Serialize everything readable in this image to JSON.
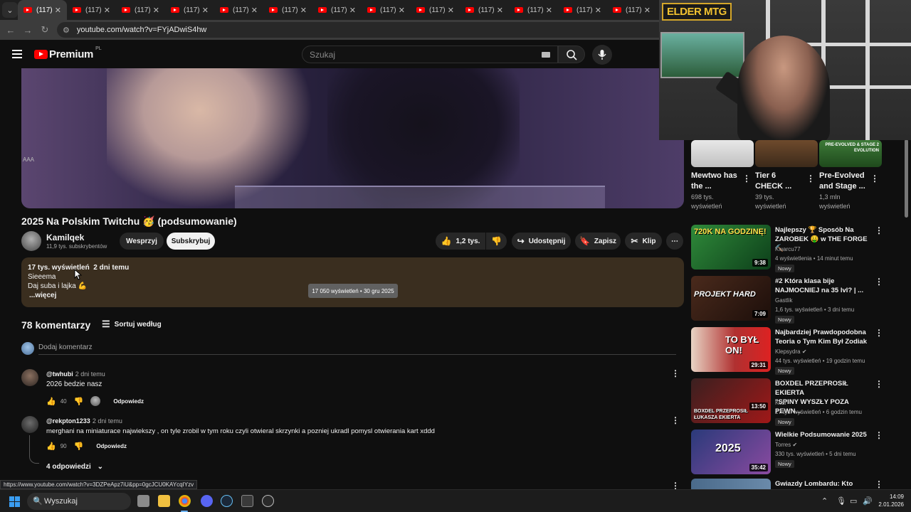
{
  "browser": {
    "tab_label": "(117)",
    "tab_count": 13,
    "url": "youtube.com/watch?v=FYjADwiS4hw",
    "status_url": "https://www.youtube.com/watch?v=3DZPeApz7iU&pp=0gcJCU0KAYcqIYzv"
  },
  "youtube": {
    "logo_text": "Premium",
    "logo_region": "PL",
    "search_placeholder": "Szukaj"
  },
  "video": {
    "overlay_text": "AAA",
    "title": "2025 Na Polskim Twitchu 🥳 (podsumowanie)",
    "channel_name": "Kamilqek",
    "subscribers": "11,9 tys. subskrybentów",
    "support_label": "Wesprzyj",
    "subscribe_label": "Subskrybuj",
    "like_count": "1,2 tys.",
    "share_label": "Udostępnij",
    "save_label": "Zapisz",
    "clip_label": "Klip"
  },
  "description": {
    "views": "17 tys. wyświetleń",
    "date": "2 dni temu",
    "line1": "Sieeema",
    "line2": "Daj suba i lajka 💪",
    "more": "...więcej",
    "tooltip": "17 050 wyświetleń • 30 gru 2025"
  },
  "comments": {
    "count_label": "78 komentarzy",
    "sort_label": "Sortuj według",
    "add_placeholder": "Dodaj komentarz",
    "reply_label": "Odpowiedz",
    "items": [
      {
        "handle": "@twhubi",
        "time": "2 dni temu",
        "text": "2026 bedzie nasz",
        "likes": "40"
      },
      {
        "handle": "@rekpton1233",
        "time": "2 dni temu",
        "text": "merghani na miniaturace najwiekszy , on tyle zrobil w tym roku czyli otwieral skrzynki a pozniej ukradl pomysl otwierania kart xddd",
        "likes": "90",
        "replies": "4 odpowiedzi"
      }
    ]
  },
  "recommendations_top": [
    {
      "title_l1": "Mewtwo has",
      "title_l2": "the ...",
      "meta_l1": "698 tys.",
      "meta_l2": "wyświetleń"
    },
    {
      "title_l1": "Tier 6",
      "title_l2": "CHECK ...",
      "meta_l1": "39 tys.",
      "meta_l2": "wyświetleń"
    },
    {
      "title_l1": "Pre-Evolved",
      "title_l2": "and Stage ...",
      "meta_l1": "1,3 mln",
      "meta_l2": "wyświetleń",
      "thumb_text": "PRE-EVOLVED & STAGE 2 EVOLUTION"
    }
  ],
  "recommendations": [
    {
      "title_l1": "Najlepszy 🏆 Sposób Na",
      "title_l2": "ZAROBEK 🤑 w THE FORGE⛏️",
      "channel": "Kwarcu77",
      "meta": "4 wyświetlenia • 14 minut temu",
      "badge": "Nowy",
      "duration": "9:38",
      "thumb_text": "720K NA GODZINĘ!"
    },
    {
      "title_l1": "#2 Która klasa bije",
      "title_l2": "NAJMOCNIEJ na 35 lvl? | ...",
      "channel": "Gastlik",
      "meta": "1,6 tys. wyświetleń • 3 dni temu",
      "badge": "Nowy",
      "duration": "7:09",
      "thumb_text": "PROJEKT HARD"
    },
    {
      "title_l1": "Najbardziej Prawdopodobna",
      "title_l2": "Teoria o Tym Kim Był Zodiak",
      "channel": "Klepsydra",
      "meta": "44 tys. wyświetleń • 19 godzin temu",
      "badge": "Nowy",
      "duration": "29:31",
      "thumb_text": "TO BYŁ ON!"
    },
    {
      "title_l1": "BOXDEL PRZEPROSIŁ EKIERTA",
      "title_l2": "\"SPINY WYSZŁY POZA PEWN...",
      "channel": "Kozi",
      "meta": "27 tys. wyświetleń • 6 godzin temu",
      "badge": "Nowy",
      "duration": "13:50",
      "thumb_text": "BOXDEL PRZEPROSIŁ ŁUKASZA EKIERTA"
    },
    {
      "title_l1": "Wielkie Podsumowanie 2025",
      "title_l2": "",
      "channel": "Torres",
      "meta": "330 tys. wyświetleń • 5 dni temu",
      "badge": "Nowy",
      "duration": "35:42",
      "thumb_text": "2025"
    },
    {
      "title_l1": "Gwiazdy Lombardu: Kto zbuduje",
      "title_l2": "",
      "channel": "",
      "meta": "",
      "badge": "",
      "duration": "",
      "thumb_text": ""
    }
  ],
  "webcam": {
    "brand_text": "ELDER MTG"
  },
  "taskbar": {
    "search_label": "Wyszukaj",
    "time": "14:09",
    "date": "2.01.2026"
  },
  "colors": {
    "youtube_red": "#ff0000",
    "description_bg": "#3a2e1f",
    "background": "#0f0f0f"
  }
}
